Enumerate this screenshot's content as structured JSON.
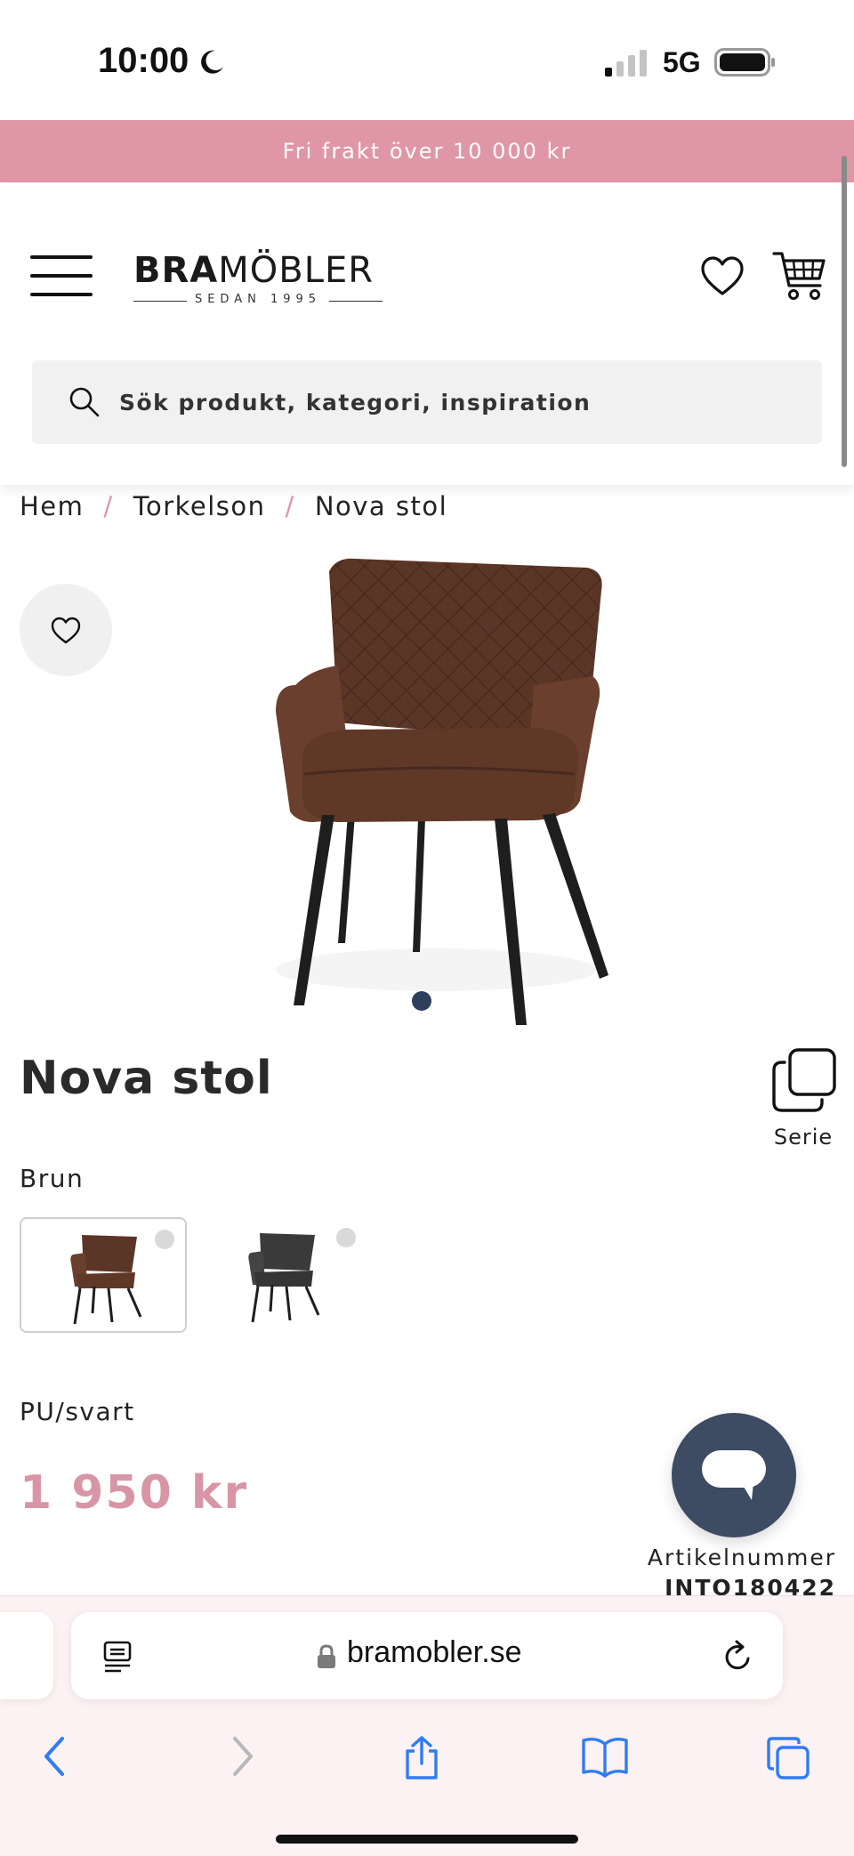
{
  "status_bar": {
    "time": "10:00",
    "network": "5G"
  },
  "promo": {
    "text": "Fri frakt över 10 000 kr"
  },
  "header": {
    "logo_bold": "BRA",
    "logo_light": "MÖBLER",
    "logo_sub": "SEDAN 1995",
    "search_placeholder": "Sök produkt, kategori, inspiration"
  },
  "breadcrumb": {
    "items": [
      "Hem",
      "Torkelson",
      "Nova stol"
    ],
    "separator": "/"
  },
  "product": {
    "title": "Nova stol",
    "serie_label": "Serie",
    "color_label": "Brun",
    "variants": [
      {
        "name": "brown",
        "color": "#5b3526",
        "selected": true
      },
      {
        "name": "black",
        "color": "#3a3a3a",
        "selected": false
      }
    ],
    "material": "PU/svart",
    "price": "1 950 kr",
    "article_label": "Artikelnummer",
    "article_number": "INTO180422",
    "carousel": {
      "current": 1,
      "total": 1
    }
  },
  "browser": {
    "url": "bramobler.se"
  },
  "colors": {
    "accent_pink": "#df96a5",
    "price_pink": "#d895a6",
    "chat_navy": "#3d4b63",
    "ios_blue": "#2f7cf6"
  }
}
